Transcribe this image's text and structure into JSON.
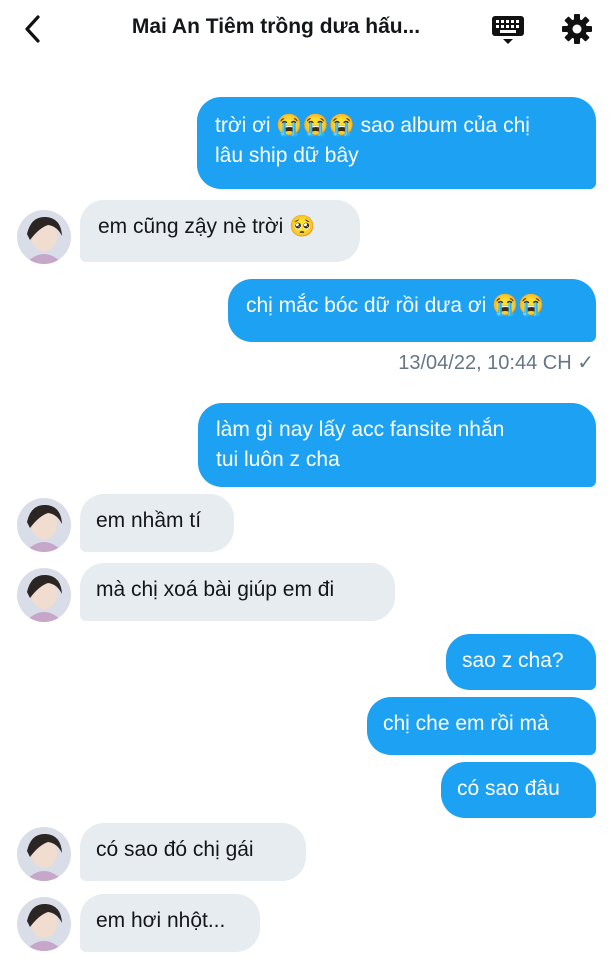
{
  "header": {
    "title": "Mai An Tiêm trồng dưa hấu...",
    "back_icon": "chevron-left-icon",
    "keyboard_icon": "keyboard-icon",
    "settings_icon": "gear-icon"
  },
  "colors": {
    "sent_bubble": "#1da1f2",
    "received_bubble": "#e6ecf0",
    "timestamp_text": "#657786"
  },
  "messages": [
    {
      "side": "sent",
      "line1": "trời ơi 😭😭😭 sao album của chị",
      "line2": "lâu ship dữ bây"
    },
    {
      "side": "received",
      "text": "em cũng zậy nè trời 🥺"
    },
    {
      "side": "sent",
      "text": "chị mắc bóc dữ rồi dưa ơi 😭😭"
    },
    {
      "side": "sent",
      "line1": "làm gì nay lấy acc fansite nhắn",
      "line2": "tui luôn z cha"
    },
    {
      "side": "received",
      "text": "em nhầm tí"
    },
    {
      "side": "received",
      "text": "mà chị xoá bài giúp em đi"
    },
    {
      "side": "sent",
      "text": "sao z cha?"
    },
    {
      "side": "sent",
      "text": "chị che em rồi mà"
    },
    {
      "side": "sent",
      "text": "có sao đâu"
    },
    {
      "side": "received",
      "text": "có sao đó chị gái"
    },
    {
      "side": "received",
      "text": "em hơi nhột..."
    }
  ],
  "timestamp": "13/04/22, 10:44 CH ✓"
}
